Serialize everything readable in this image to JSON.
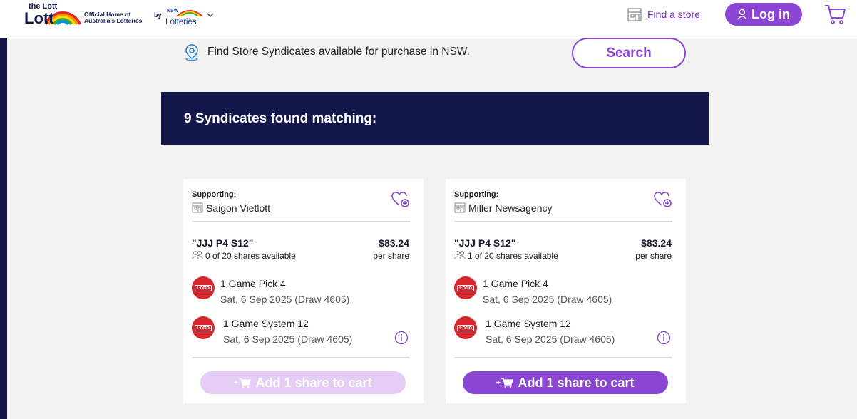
{
  "header": {
    "logo_brand": "the Lott",
    "logo_tagline_line1": "Official Home of",
    "logo_tagline_line2": "Australia's Lotteries",
    "by_label": "by",
    "nsw_top": "NSW",
    "nsw_bottom": "Lotteries",
    "find_store_label": "Find a store",
    "login_label": "Log in"
  },
  "search": {
    "description": "Find Store Syndicates available for purchase in NSW.",
    "button_label": "Search"
  },
  "results": {
    "banner_text": "9 Syndicates found matching:"
  },
  "cards": [
    {
      "supporting_label": "Supporting:",
      "store_name": "Saigon Vietlott",
      "syndicate_name": "\"JJJ P4 S12\"",
      "price": "$83.24",
      "per_share": "per share",
      "shares": "0 of 20 shares available",
      "games": [
        {
          "title": "1 Game Pick 4",
          "date": "Sat, 6 Sep 2025 (Draw 4605)"
        },
        {
          "title": "1 Game System 12",
          "date": "Sat, 6 Sep 2025 (Draw 4605)"
        }
      ],
      "add_label": "Add 1 share to cart",
      "enabled": false
    },
    {
      "supporting_label": "Supporting:",
      "store_name": "Miller Newsagency",
      "syndicate_name": "\"JJJ P4 S12\"",
      "price": "$83.24",
      "per_share": "per share",
      "shares": "1 of 20 shares available",
      "games": [
        {
          "title": "1 Game Pick 4",
          "date": "Sat, 6 Sep 2025 (Draw 4605)"
        },
        {
          "title": "1 Game System 12",
          "date": "Sat, 6 Sep 2025 (Draw 4605)"
        }
      ],
      "add_label": "Add 1 share to cart",
      "enabled": true
    }
  ],
  "game_badge_label": "Lotto",
  "colors": {
    "navy": "#14174a",
    "purple": "#8a45d1",
    "purple_disabled": "#e6cdf5",
    "lotto_red": "#d8262e"
  }
}
